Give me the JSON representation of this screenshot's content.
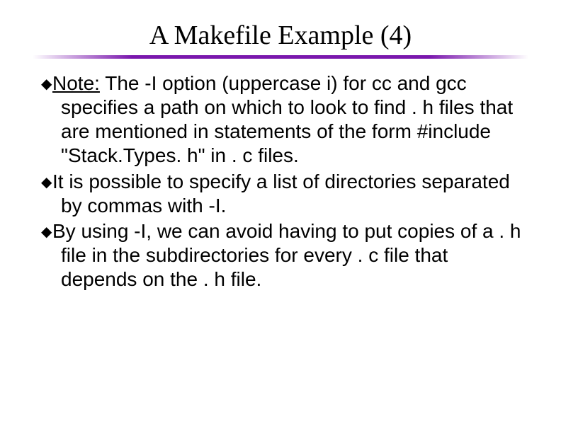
{
  "title": "A Makefile Example (4)",
  "bullets": [
    {
      "runs": [
        {
          "t": "Note:",
          "u": true
        },
        {
          "t": " The -I option (uppercase i) for cc and gcc specifies a path on which to look to find . h files that are mentioned in statements of the form #include \"Stack.Types. h\" in . c files."
        }
      ]
    },
    {
      "runs": [
        {
          "t": "It is possible to specify a list of directories separated by commas with -I."
        }
      ]
    },
    {
      "runs": [
        {
          "t": "By using -I, we can avoid having to put copies of a . h file in the subdirectories for every . c file that depends on the . h file."
        }
      ]
    }
  ]
}
